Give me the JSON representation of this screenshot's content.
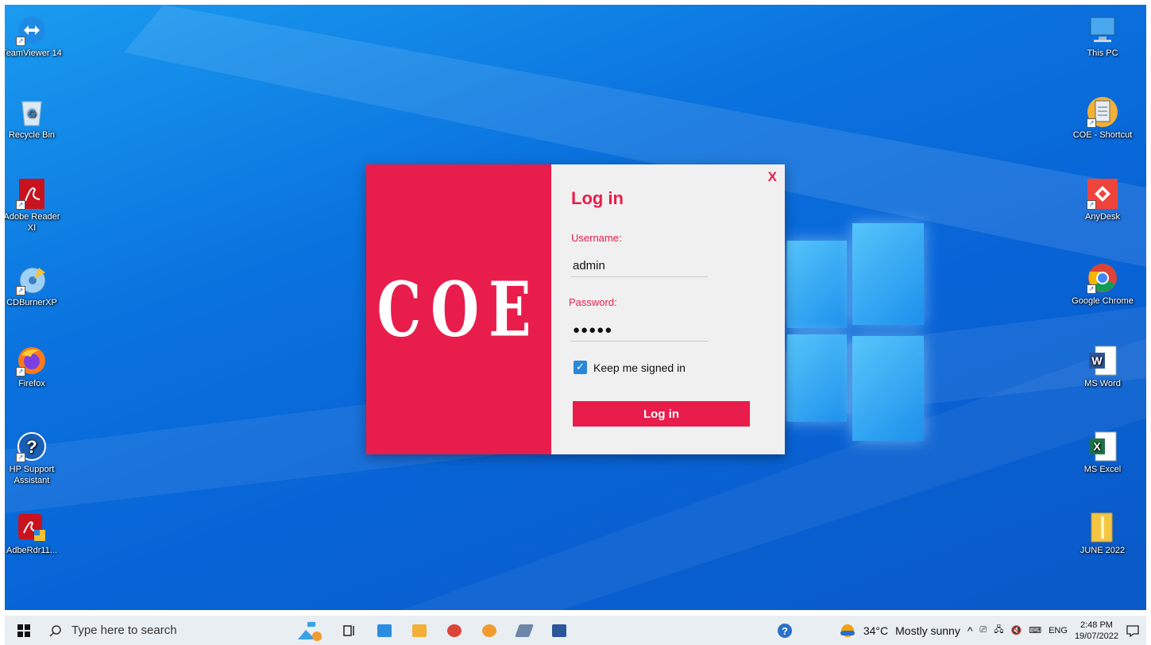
{
  "desktop": {
    "left_icons": [
      {
        "label": "TeamViewer 14",
        "icon": "teamviewer-icon",
        "color": "#1e8ae6"
      },
      {
        "label": "Recycle Bin",
        "icon": "recycle-bin-icon",
        "color": "#cfe3f5"
      },
      {
        "label": "Adobe Reader XI",
        "icon": "adobe-reader-icon",
        "color": "#c8131f"
      },
      {
        "label": "CDBurnerXP",
        "icon": "cdburnerxp-icon",
        "color": "#5aa9e6"
      },
      {
        "label": "Firefox",
        "icon": "firefox-icon",
        "color": "#ff7a1a"
      },
      {
        "label": "HP Support Assistant",
        "icon": "help-icon",
        "color": "#1b5fb5"
      },
      {
        "label": "AdbeRdr11...",
        "icon": "adobe-installer-icon",
        "color": "#c8131f"
      }
    ],
    "right_icons": [
      {
        "label": "This PC",
        "icon": "monitor-icon",
        "color": "#4aa8ee"
      },
      {
        "label": "COE - Shortcut",
        "icon": "coe-shortcut-icon",
        "color": "#f2b136"
      },
      {
        "label": "AnyDesk",
        "icon": "anydesk-icon",
        "color": "#ef443b"
      },
      {
        "label": "Google Chrome",
        "icon": "chrome-icon",
        "color": "#4285f4"
      },
      {
        "label": "MS Word",
        "icon": "word-icon",
        "color": "#2b579a"
      },
      {
        "label": "MS Excel",
        "icon": "excel-icon",
        "color": "#217346"
      },
      {
        "label": "JUNE 2022",
        "icon": "folder-icon",
        "color": "#f4c542"
      }
    ]
  },
  "dialog": {
    "brand_text": "COE",
    "close_label": "X",
    "title": "Log in",
    "username_label": "Username:",
    "username_value": "admin",
    "password_label": "Password:",
    "password_mask": "●●●●●",
    "keep_signed_in_label": "Keep me signed in",
    "keep_signed_in_checked": true,
    "submit_label": "Log in",
    "accent_color": "#e81d4b"
  },
  "taskbar": {
    "search_placeholder": "Type here to search",
    "pinned": [
      {
        "name": "widgets-icon",
        "color": "#3aa0e8"
      },
      {
        "name": "task-view-icon",
        "color": "#222222"
      },
      {
        "name": "this-pc-icon",
        "color": "#2b8de0"
      },
      {
        "name": "file-explorer-icon",
        "color": "#f2b136"
      },
      {
        "name": "chrome-icon",
        "color": "#db4437"
      },
      {
        "name": "coe-app-icon",
        "color": "#f29b2e"
      },
      {
        "name": "app-bolt-icon",
        "color": "#6e86a8"
      },
      {
        "name": "word-icon",
        "color": "#2b579a"
      }
    ],
    "tray": {
      "help_icon": "help-icon",
      "weather_temp": "34°C",
      "weather_text": "Mostly sunny",
      "language": "ENG",
      "time": "2:48 PM",
      "date": "19/07/2022"
    }
  }
}
